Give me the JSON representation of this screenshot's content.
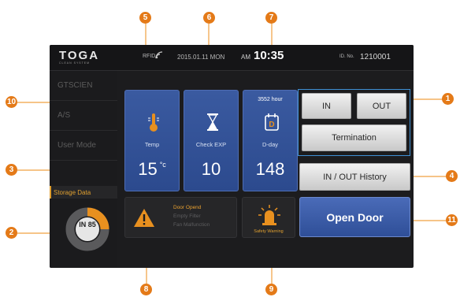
{
  "header": {
    "logo": "TOGA",
    "logo_sub": "CLEAN SYSTEM",
    "rfid_label": "RFID",
    "date": "2015.01.11 MON",
    "ampm": "AM",
    "time": "10:35",
    "id_label": "ID. No.",
    "id_value": "1210001"
  },
  "sidebar": {
    "items": [
      "GTSCIEN",
      "A/S",
      "User Mode"
    ],
    "storage_label": "Storage Data",
    "donut_label": "IN 85",
    "donut_fraction": 0.25,
    "donut_colors": {
      "fill": "#e8901f",
      "track": "#5a5a5c"
    }
  },
  "tiles": [
    {
      "icon": "thermometer-icon",
      "label": "Temp",
      "value": "15",
      "unit": "°c"
    },
    {
      "icon": "hourglass-icon",
      "label": "Check EXP",
      "value": "10"
    },
    {
      "icon": "calendar-d-icon",
      "label": "D-day",
      "value": "148",
      "hours": "3552 hour"
    }
  ],
  "buttons": {
    "in": "IN",
    "out": "OUT",
    "termination": "Termination",
    "history": "IN / OUT History",
    "open_door": "Open Door"
  },
  "alerts": {
    "lines": [
      "Door Opend",
      "Empty Filter",
      "Fan Malfunction"
    ],
    "active_color": "#e8a030",
    "inactive_color": "#5d5d5f"
  },
  "safety": {
    "label": "Safety Warning"
  },
  "callouts": [
    "1",
    "2",
    "3",
    "4",
    "5",
    "6",
    "7",
    "8",
    "9",
    "10",
    "11"
  ],
  "colors": {
    "callout": "#e47a18",
    "frame": "#3f8fd4",
    "tile": "#3a5aa0"
  }
}
